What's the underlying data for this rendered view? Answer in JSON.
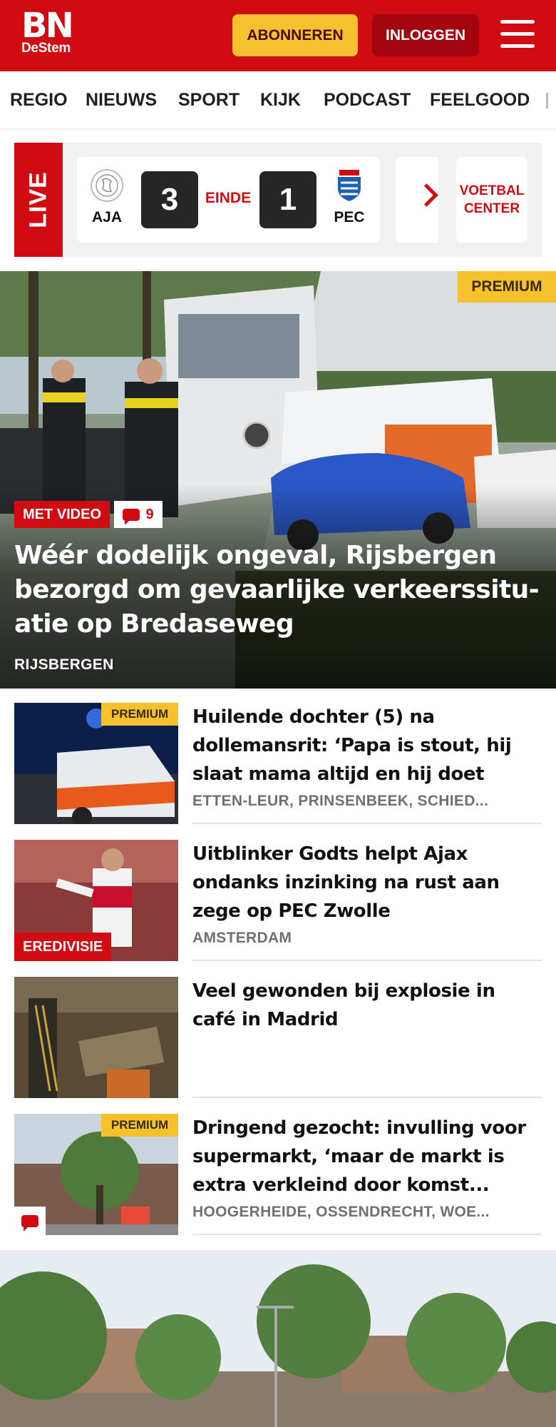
{
  "header": {
    "logo_main": "BN",
    "logo_sub": "DeStem",
    "subscribe_label": "ABONNEREN",
    "login_label": "INLOGGEN"
  },
  "nav": {
    "items": [
      "REGIO",
      "NIEUWS",
      "SPORT",
      "KIJK",
      "PODCAST",
      "FEELGOOD"
    ]
  },
  "live": {
    "label": "LIVE",
    "home_team": "AJA",
    "home_score": "3",
    "status": "EINDE",
    "away_score": "1",
    "away_team": "PEC",
    "center_line1": "VOETBAL",
    "center_line2": "CENTER"
  },
  "hero": {
    "premium": "PREMIUM",
    "video_tag": "MET VIDEO",
    "comment_count": "9",
    "title": "Wéér dodelijk ongeval, Rijsbergen bezorgd om gevaarlijke verkeerssitu-atie op Bredaseweg",
    "location": "RIJSBERGEN"
  },
  "articles": [
    {
      "premium": "PREMIUM",
      "title": "Huilende dochter (5) na dollemansrit: ‘Papa is stout, hij slaat mama altijd en hij doet oo...",
      "location": "ETTEN-LEUR, PRINSENBEEK, SCHIED..."
    },
    {
      "tag": "EREDIVISIE",
      "title": "Uitblinker Godts helpt Ajax ondanks inzinking na rust aan zege op PEC Zwolle",
      "location": "AMSTERDAM"
    },
    {
      "title": "Veel gewonden bij explosie in café in Madrid"
    },
    {
      "premium": "PREMIUM",
      "title": "Dringend gezocht: invulling voor supermarkt, ‘maar de markt is extra verkleind door komst...",
      "location": "HOOGERHEIDE, OSSENDRECHT, WOE..."
    }
  ],
  "colors": {
    "brand_red": "#d00c12",
    "premium_yellow": "#f5c12d",
    "login_dark_red": "#a30510",
    "location_gray": "#707070"
  },
  "icons": [
    "hamburger-menu-icon",
    "chevron-right-icon",
    "comment-icon",
    "ajax-logo-icon",
    "pec-zwolle-logo-icon"
  ]
}
